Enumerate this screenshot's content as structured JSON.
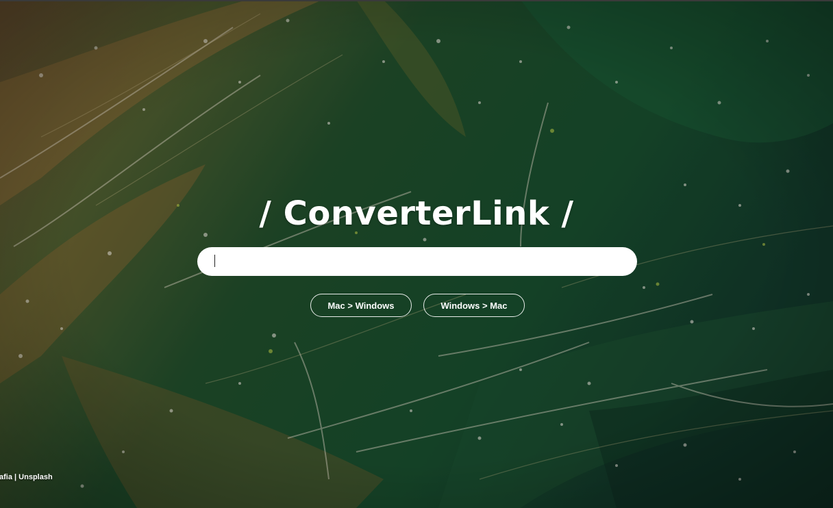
{
  "brand": {
    "title": "/ ConverterLink /"
  },
  "search": {
    "value": "",
    "placeholder": ""
  },
  "buttons": {
    "mac_to_windows": "Mac > Windows",
    "windows_to_mac": "Windows > Mac"
  },
  "credit": {
    "photographer": "grafia",
    "separator": " | ",
    "source": "Unsplash"
  },
  "colors": {
    "background_primary": "#1f4a2c",
    "background_secondary": "#7a5a2a",
    "text": "#ffffff",
    "input_bg": "#ffffff"
  },
  "icons": {
    "background": "algae-water-photo"
  }
}
